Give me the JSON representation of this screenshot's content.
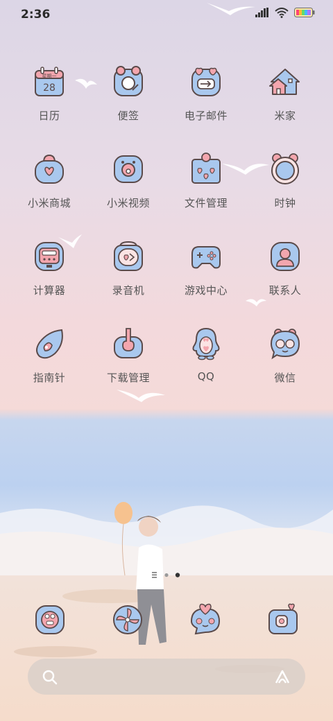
{
  "status": {
    "time": "2:36"
  },
  "apps": [
    {
      "label": "日历",
      "icon": "calendar-icon",
      "cal_line1": "星期一",
      "cal_line2": "28"
    },
    {
      "label": "便签",
      "icon": "notes-icon"
    },
    {
      "label": "电子邮件",
      "icon": "email-icon"
    },
    {
      "label": "米家",
      "icon": "mijia-home-icon"
    },
    {
      "label": "小米商城",
      "icon": "mi-store-icon"
    },
    {
      "label": "小米视频",
      "icon": "mi-video-icon"
    },
    {
      "label": "文件管理",
      "icon": "file-manager-icon"
    },
    {
      "label": "时钟",
      "icon": "clock-icon"
    },
    {
      "label": "计算器",
      "icon": "calculator-icon"
    },
    {
      "label": "录音机",
      "icon": "recorder-icon"
    },
    {
      "label": "游戏中心",
      "icon": "game-center-icon"
    },
    {
      "label": "联系人",
      "icon": "contacts-icon"
    },
    {
      "label": "指南针",
      "icon": "compass-icon"
    },
    {
      "label": "下载管理",
      "icon": "downloads-icon"
    },
    {
      "label": "QQ",
      "icon": "qq-icon"
    },
    {
      "label": "微信",
      "icon": "wechat-icon"
    }
  ],
  "dock": [
    "phone-icon",
    "browser-icon",
    "messages-icon",
    "camera-icon"
  ],
  "page_indicator": {
    "pages": 2,
    "active": 2
  },
  "colors": {
    "icon_fill": "#a9c8ee",
    "icon_stroke": "#5a4a4a",
    "accent_pink": "#f3a6ae",
    "label": "#555555"
  }
}
